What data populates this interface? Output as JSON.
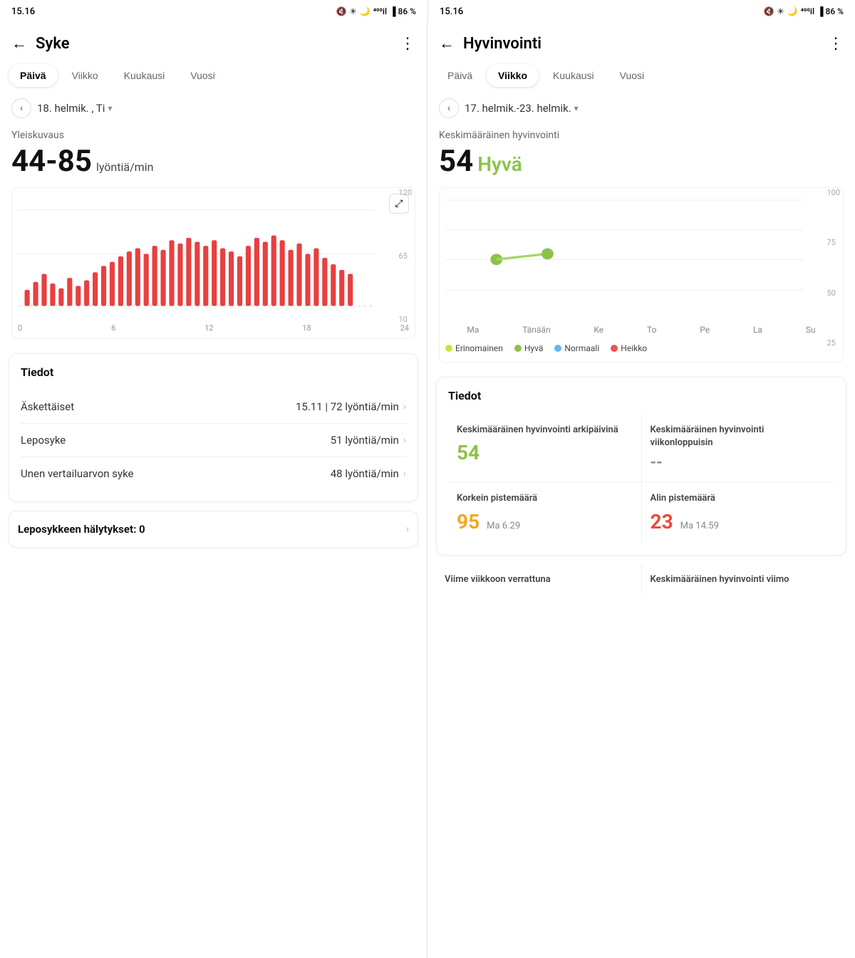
{
  "left_screen": {
    "status": {
      "time": "15.16",
      "icons": "🔇 ✦ 🌙 ⁴⁰⁰ 86 %"
    },
    "header": {
      "back_label": "←",
      "title": "Syke",
      "menu_label": "⋮"
    },
    "tabs": [
      {
        "label": "Päivä",
        "active": true
      },
      {
        "label": "Viikko",
        "active": false
      },
      {
        "label": "Kuukausi",
        "active": false
      },
      {
        "label": "Vuosi",
        "active": false
      }
    ],
    "date_nav": {
      "arrow_left": "‹",
      "date_text": "18. helmik. , Ti",
      "dropdown": "▾"
    },
    "overview": {
      "label": "Yleiskuvaus",
      "value": "44-85",
      "unit": "lyöntiä/min"
    },
    "chart": {
      "y_labels": [
        "120",
        "65",
        "10"
      ],
      "x_labels": [
        "0",
        "6",
        "12",
        "18",
        "24"
      ],
      "expand_icon": "⤢"
    },
    "info_card": {
      "title": "Tiedot",
      "rows": [
        {
          "label": "Äskettäiset",
          "value": "15.11 | 72 lyöntiä/min"
        },
        {
          "label": "Leposyke",
          "value": "51 lyöntiä/min"
        },
        {
          "label": "Unen vertailuarvon syke",
          "value": "48 lyöntiä/min"
        }
      ]
    },
    "alert": {
      "label": "Leposykkeen hälytykset: 0"
    }
  },
  "right_screen": {
    "status": {
      "time": "15.16",
      "icons": "🔇 ✦ 🌙 ⁴⁰⁰ 86 %"
    },
    "header": {
      "back_label": "←",
      "title": "Hyvinvointi",
      "menu_label": "⋮"
    },
    "tabs": [
      {
        "label": "Päivä",
        "active": false
      },
      {
        "label": "Viikko",
        "active": true
      },
      {
        "label": "Kuukausi",
        "active": false
      },
      {
        "label": "Vuosi",
        "active": false
      }
    ],
    "date_nav": {
      "arrow_left": "‹",
      "date_text": "17. helmik.-23. helmik.",
      "dropdown": "▾"
    },
    "overview": {
      "label": "Keskimääräinen hyvinvointi",
      "value": "54",
      "status": "Hyvä"
    },
    "chart": {
      "y_labels": [
        "100",
        "75",
        "50",
        "25"
      ],
      "day_labels": [
        "Ma",
        "Tänään",
        "Ke",
        "To",
        "Pe",
        "La",
        "Su"
      ],
      "legend": [
        {
          "label": "Erinomainen",
          "color": "#c8e63a"
        },
        {
          "label": "Hyvä",
          "color": "#8bc34a"
        },
        {
          "label": "Normaali",
          "color": "#64b5f6"
        },
        {
          "label": "Heikko",
          "color": "#ef5350"
        }
      ]
    },
    "info_card": {
      "title": "Tiedot",
      "cells": [
        {
          "label": "Keskimääräinen hyvinvointi arkipäivinä",
          "value": "54",
          "value_color": "green",
          "sub": ""
        },
        {
          "label": "Keskimääräinen hyvinvointi viikonloppuisin",
          "value": "--",
          "value_color": "dash",
          "sub": ""
        },
        {
          "label": "Korkein pistemäärä",
          "value": "95",
          "value_color": "orange",
          "sub": "Ma 6.29"
        },
        {
          "label": "Alin pistemäärä",
          "value": "23",
          "value_color": "red",
          "sub": "Ma 14.59"
        }
      ]
    },
    "bottom_cells": [
      {
        "label": "Viime viikkoon verrattuna"
      },
      {
        "label": "Keskimääräinen hyvinvointi viimo"
      }
    ]
  }
}
